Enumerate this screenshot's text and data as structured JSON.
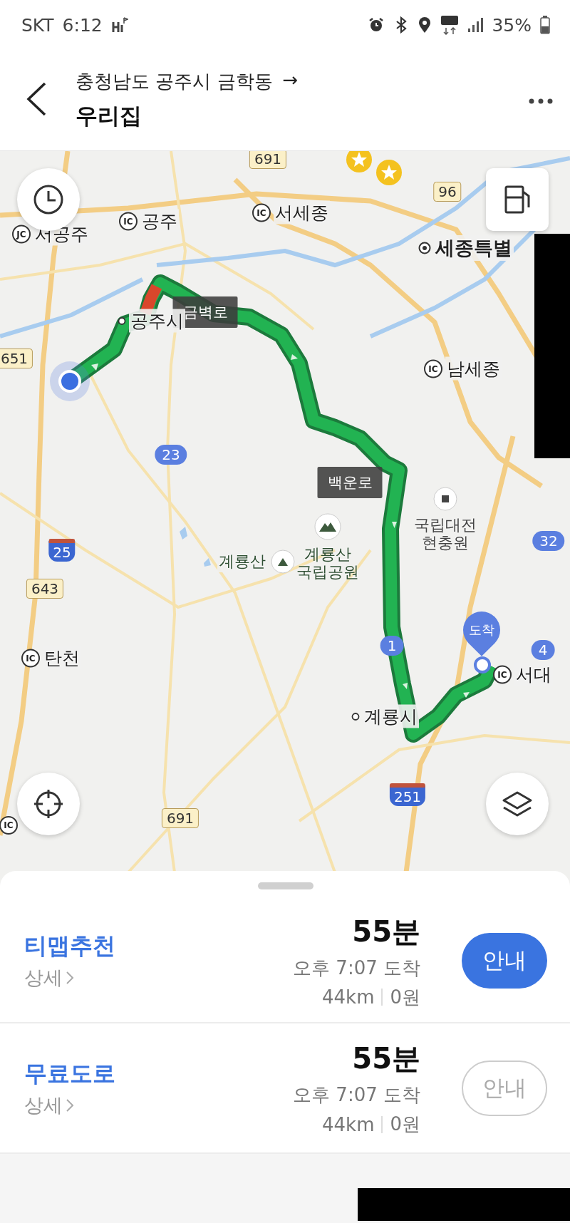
{
  "status_bar": {
    "carrier": "SKT",
    "time": "6:12",
    "battery": "35%"
  },
  "header": {
    "origin": "충청남도 공주시 금학동",
    "arrow": "→",
    "destination": "우리집"
  },
  "map": {
    "labels": [
      {
        "kind": "national",
        "text": "691"
      },
      {
        "kind": "national",
        "text": "96"
      },
      {
        "kind": "junction",
        "badge": "JC",
        "text": "서공주"
      },
      {
        "kind": "junction",
        "badge": "IC",
        "text": "공주"
      },
      {
        "kind": "junction",
        "badge": "IC",
        "text": "서세종"
      },
      {
        "kind": "city",
        "text": "세종특별"
      },
      {
        "kind": "road_name",
        "text": "금벽로"
      },
      {
        "kind": "town",
        "text": "공주시"
      },
      {
        "kind": "national",
        "text": "651"
      },
      {
        "kind": "junction",
        "badge": "IC",
        "text": "남세종"
      },
      {
        "kind": "local",
        "text": "23"
      },
      {
        "kind": "road_name",
        "text": "백운로"
      },
      {
        "kind": "poi",
        "text": "국립대전 현충원"
      },
      {
        "kind": "mountain",
        "text": "계룡산"
      },
      {
        "kind": "park",
        "text": "계룡산 국립공원"
      },
      {
        "kind": "national",
        "text": "643"
      },
      {
        "kind": "local",
        "text": "32"
      },
      {
        "kind": "junction",
        "badge": "IC",
        "text": "탄천"
      },
      {
        "kind": "local",
        "text": "1"
      },
      {
        "kind": "local",
        "text": "4"
      },
      {
        "kind": "junction",
        "badge": "IC",
        "text": "서대"
      },
      {
        "kind": "town",
        "text": "계룡시"
      },
      {
        "kind": "expressway",
        "text": "251"
      },
      {
        "kind": "national",
        "text": "691"
      },
      {
        "kind": "expressway",
        "text": "25"
      },
      {
        "kind": "junction",
        "badge": "IC"
      }
    ],
    "destination_pin": "도착"
  },
  "routes": [
    {
      "name": "티맵추천",
      "detail": "상세",
      "duration": "55분",
      "arrival": "오후 7:07 도착",
      "distance": "44km",
      "fare": "0원",
      "button": "안내",
      "selected": true
    },
    {
      "name": "무료도로",
      "detail": "상세",
      "duration": "55분",
      "arrival": "오후 7:07 도착",
      "distance": "44km",
      "fare": "0원",
      "button": "안내",
      "selected": false
    }
  ]
}
